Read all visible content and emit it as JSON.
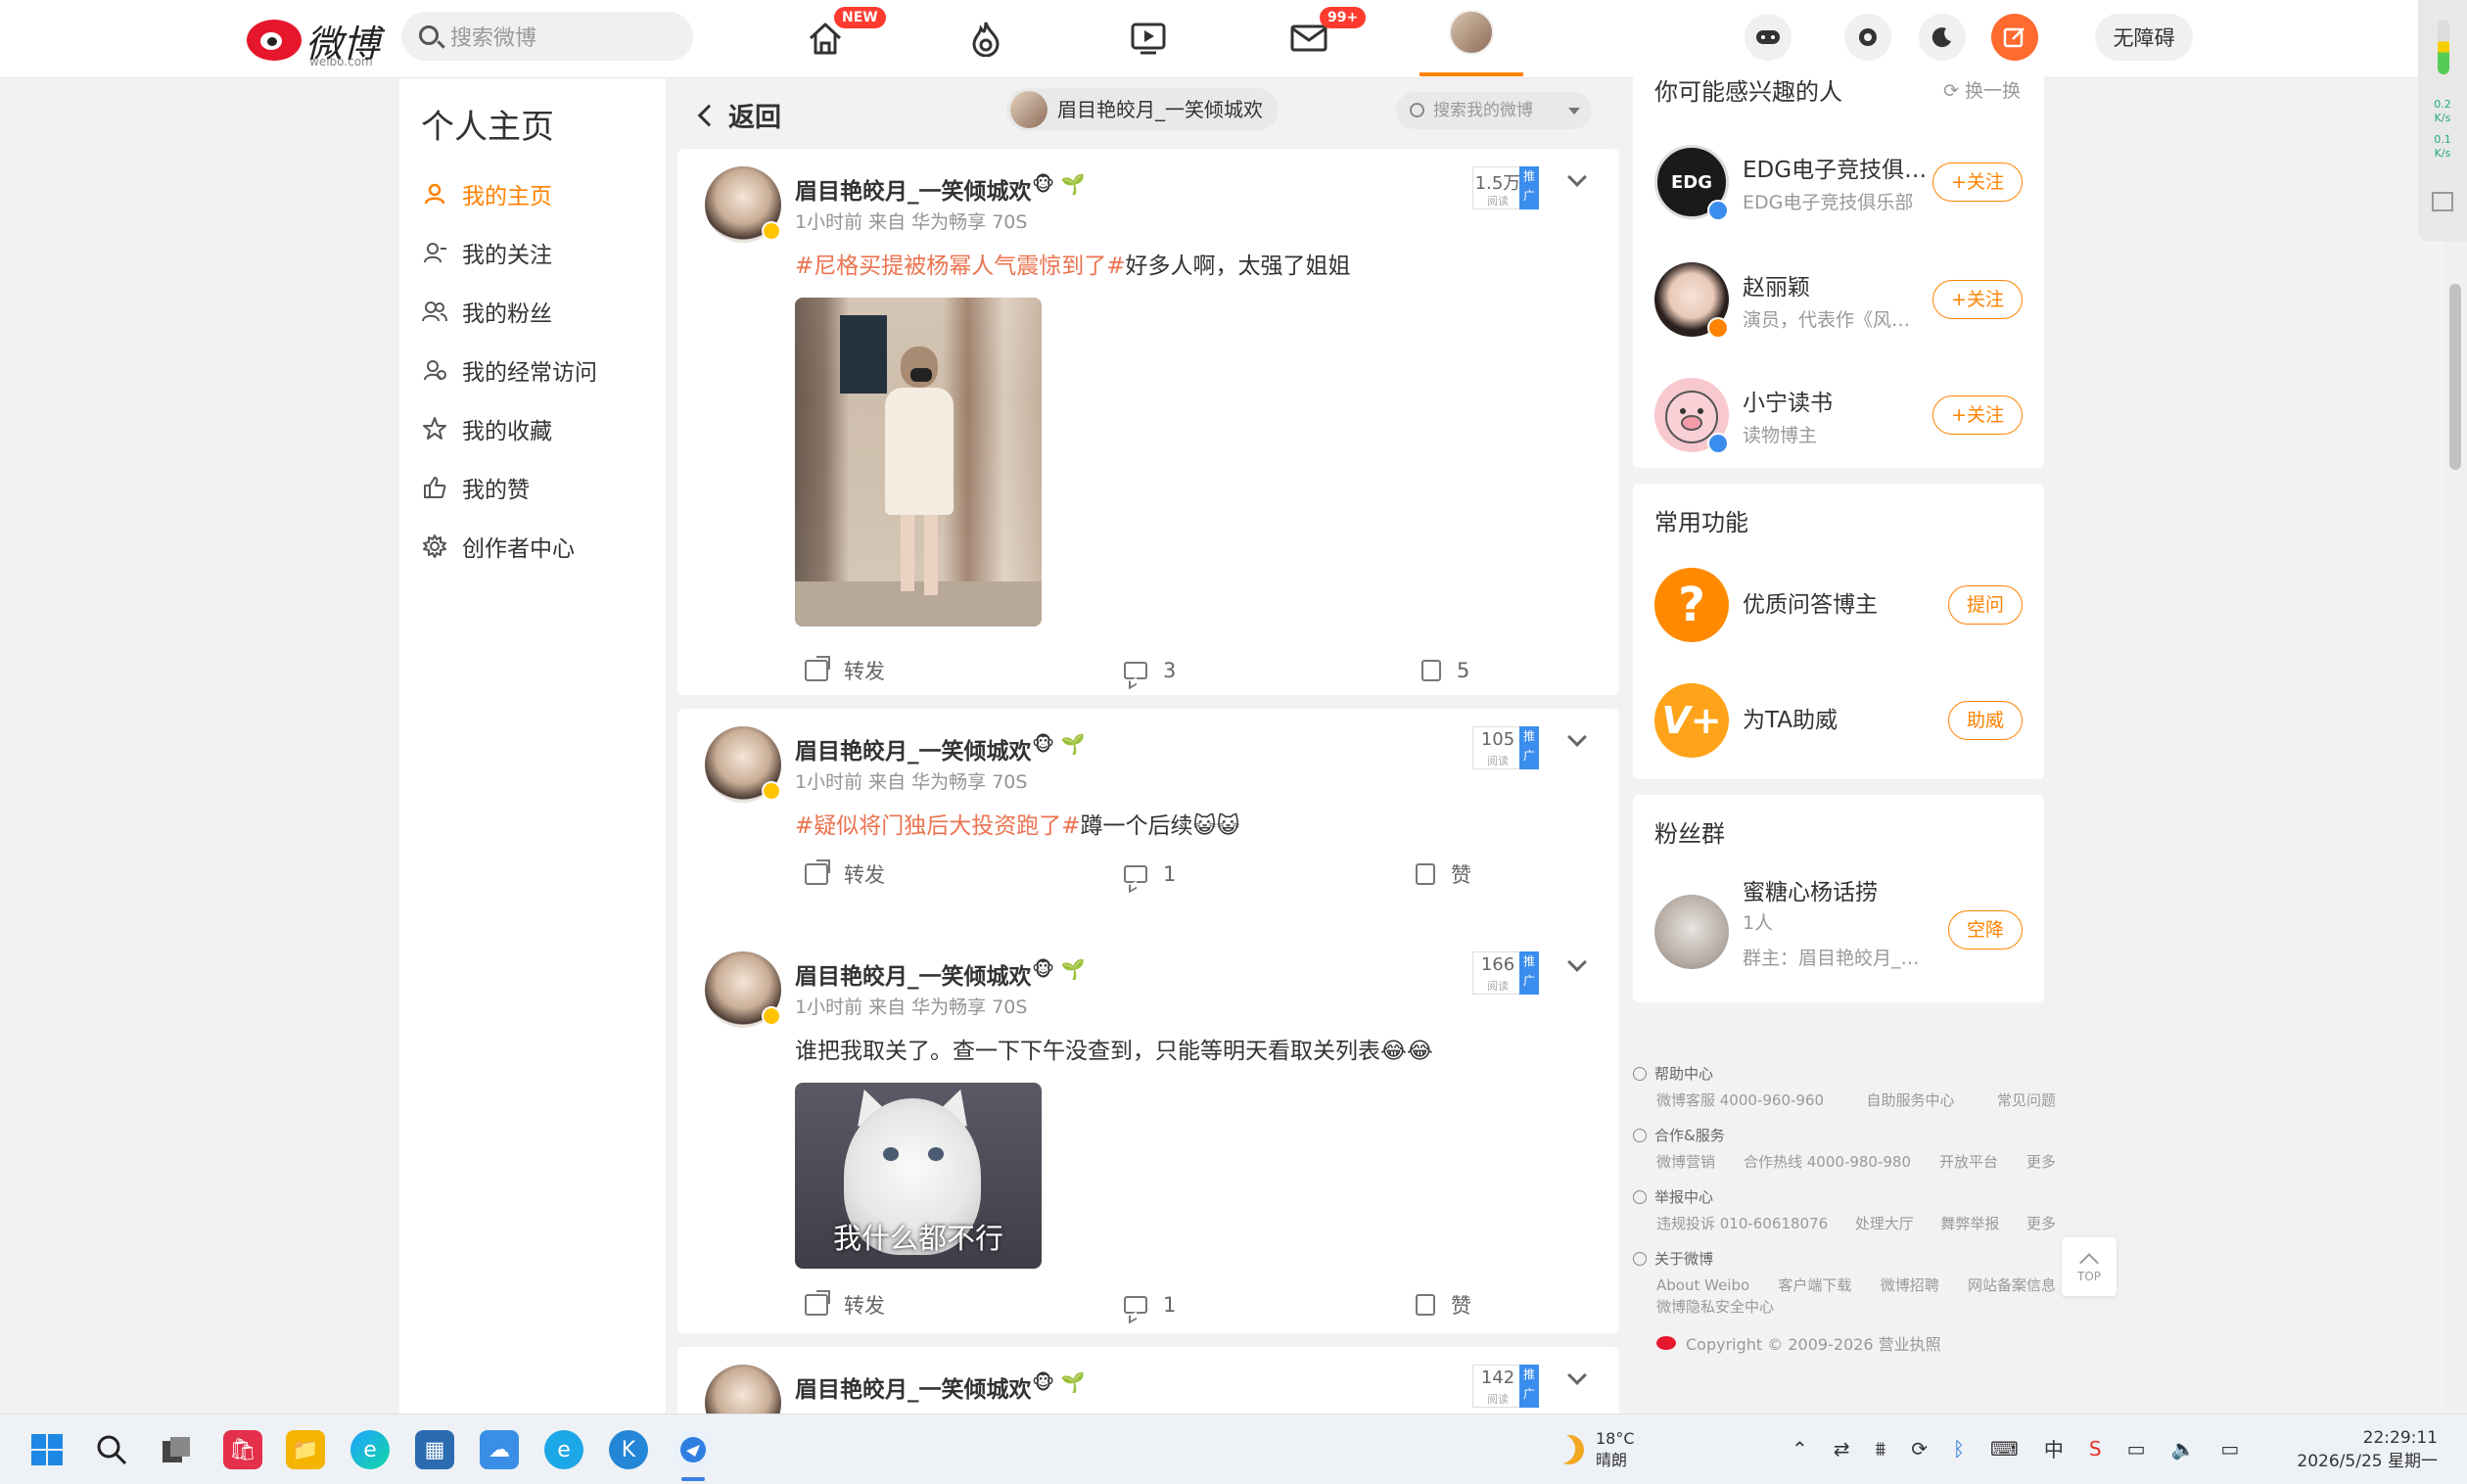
{
  "app": {
    "logo_text": "微博",
    "logo_sub": "weibo.com"
  },
  "topnav": {
    "search_placeholder": "搜索微博",
    "home_badge": "NEW",
    "messages_badge": "99+",
    "accessibility_label": "无障碍",
    "icons": [
      "home-icon",
      "hot-icon",
      "video-icon",
      "message-icon",
      "profile-avatar",
      "game-icon",
      "settings-icon",
      "dark-mode-icon",
      "compose-icon"
    ]
  },
  "leftbar": {
    "title": "个人主页",
    "items": [
      {
        "label": "我的主页",
        "icon": "person-icon",
        "active": true
      },
      {
        "label": "我的关注",
        "icon": "follow-icon"
      },
      {
        "label": "我的粉丝",
        "icon": "fans-icon"
      },
      {
        "label": "我的经常访问",
        "icon": "visit-icon"
      },
      {
        "label": "我的收藏",
        "icon": "star-icon"
      },
      {
        "label": "我的赞",
        "icon": "thumb-icon"
      },
      {
        "label": "创作者中心",
        "icon": "gear-icon"
      }
    ]
  },
  "feed": {
    "back_label": "返回",
    "user_chip": "眉目艳皎月_一笑倾城欢",
    "search_placeholder": "搜索我的微博",
    "posts": [
      {
        "author": "眉目艳皎月_一笑倾城欢",
        "meta": "1小时前 来自 华为畅享 70S",
        "reads": "1.5万",
        "reads_label": "阅读",
        "promote": "推广",
        "tag": "#尼格买提被杨幂人气震惊到了#",
        "text": "好多人啊，太强了姐姐",
        "share": "转发",
        "comments": "3",
        "likes": "5"
      },
      {
        "author": "眉目艳皎月_一笑倾城欢",
        "meta": "1小时前 来自 华为畅享 70S",
        "reads": "105",
        "reads_label": "阅读",
        "promote": "推广",
        "tag": "#疑似将门独后大投资跑了#",
        "text": "蹲一个后续😺😺",
        "share": "转发",
        "comments": "1",
        "likes": "赞"
      },
      {
        "author": "眉目艳皎月_一笑倾城欢",
        "meta": "1小时前 来自 华为畅享 70S",
        "reads": "166",
        "reads_label": "阅读",
        "promote": "推广",
        "tag": "",
        "text": "谁把我取关了。查一下下午没查到，只能等明天看取关列表😂😂",
        "image_caption": "我什么都不行",
        "share": "转发",
        "comments": "1",
        "likes": "赞"
      },
      {
        "author": "眉目艳皎月_一笑倾城欢",
        "reads": "142",
        "reads_label": "阅读",
        "promote": "推广"
      }
    ]
  },
  "right": {
    "suggest": {
      "title": "你可能感兴趣的人",
      "refresh": "换一换",
      "follow_label": "+关注",
      "people": [
        {
          "name": "EDG电子竞技俱乐部",
          "desc": "EDG电子竞技俱乐部"
        },
        {
          "name": "赵丽颖",
          "desc": "演员，代表作《风吹半夏》"
        },
        {
          "name": "小宁读书",
          "desc": "读物博主"
        }
      ]
    },
    "functions": {
      "title": "常用功能",
      "items": [
        {
          "name": "优质问答博主",
          "button": "提问"
        },
        {
          "name": "为TA助威",
          "button": "助威"
        }
      ]
    },
    "fans_group": {
      "title": "粉丝群",
      "name": "蜜糖心杨话捞",
      "count": "1人",
      "owner": "群主：眉目艳皎月_一笑倾城欢",
      "button": "空降"
    },
    "footer": {
      "help": {
        "title": "帮助中心",
        "links": [
          "微博客服 4000-960-960",
          "自助服务中心",
          "常见问题"
        ]
      },
      "coop": {
        "title": "合作&服务",
        "links": [
          "微博营销",
          "合作热线 4000-980-980",
          "开放平台",
          "更多"
        ]
      },
      "report": {
        "title": "举报中心",
        "links": [
          "违规投诉 010-60618076",
          "处理大厅",
          "舞弊举报",
          "更多"
        ]
      },
      "about": {
        "title": "关于微博",
        "links": [
          "About Weibo",
          "客户端下载",
          "微博招聘",
          "网站备案信息"
        ],
        "links2": [
          "微博隐私安全中心"
        ]
      },
      "copyright": "Copyright © 2009-2026 营业执照",
      "top": "TOP"
    }
  },
  "netwidget": {
    "up": "0.2",
    "down": "0.1",
    "unit": "K/s"
  },
  "taskbar": {
    "weather_temp": "18°C",
    "weather_desc": "晴朗",
    "ime": "中",
    "time": "22:29:11",
    "date": "2026/5/25 星期一"
  }
}
